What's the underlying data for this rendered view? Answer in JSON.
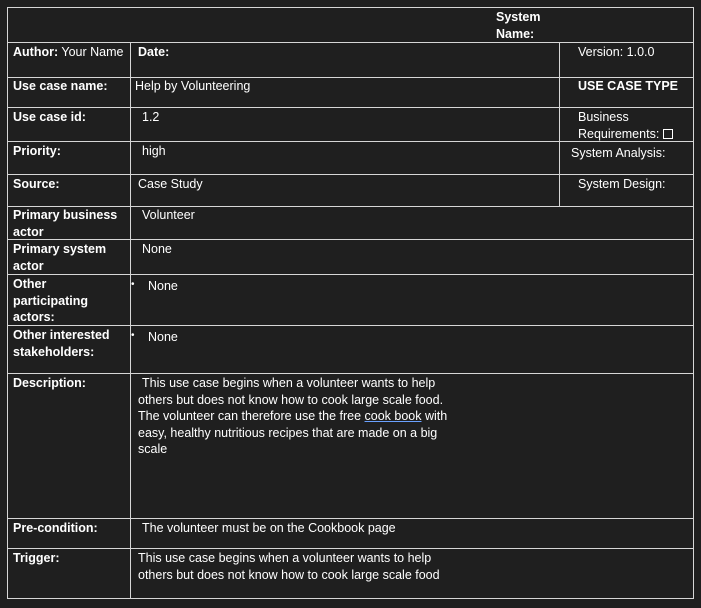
{
  "header": {
    "system_name_label": "System Name:"
  },
  "author": {
    "label": "Author:",
    "value": "Your Name"
  },
  "date": {
    "label": "Date:"
  },
  "version": {
    "label": "Version:",
    "value": "1.0.0"
  },
  "use_case_name": {
    "label": "Use case name:",
    "value": "Help by Volunteering"
  },
  "use_case_type": {
    "label": "USE CASE TYPE"
  },
  "use_case_id": {
    "label": "Use case id:",
    "value": "1.2"
  },
  "business_requirements": {
    "label": "Business Requirements:"
  },
  "priority": {
    "label": "Priority:",
    "value": "high"
  },
  "system_analysis": {
    "label": "System Analysis:"
  },
  "source": {
    "label": "Source:",
    "value": "Case Study"
  },
  "system_design": {
    "label": "System Design:"
  },
  "primary_business_actor": {
    "label": "Primary business actor",
    "value": "Volunteer"
  },
  "primary_system_actor": {
    "label": "Primary system actor",
    "value": "None"
  },
  "other_participating_actors": {
    "label": "Other participating actors:",
    "value": "None"
  },
  "other_interested_stakeholders": {
    "label": "Other interested stakeholders:",
    "value": "None"
  },
  "description": {
    "label": "Description:",
    "line1": "This use case begins when a volunteer wants to help",
    "line2": "others but does not know how to cook large scale food.",
    "line3_pre": "The volunteer can therefore use the free ",
    "line3_link": "cook book",
    "line3_post": " with",
    "line4": "easy, healthy nutritious recipes that are made on a big",
    "line5": "scale"
  },
  "precondition": {
    "label": "Pre-condition:",
    "value": "The volunteer must be on the Cookbook page"
  },
  "trigger": {
    "label": "Trigger:",
    "line1": "This use case begins when a volunteer wants to help",
    "line2": "others but does not know how to cook large scale food"
  }
}
